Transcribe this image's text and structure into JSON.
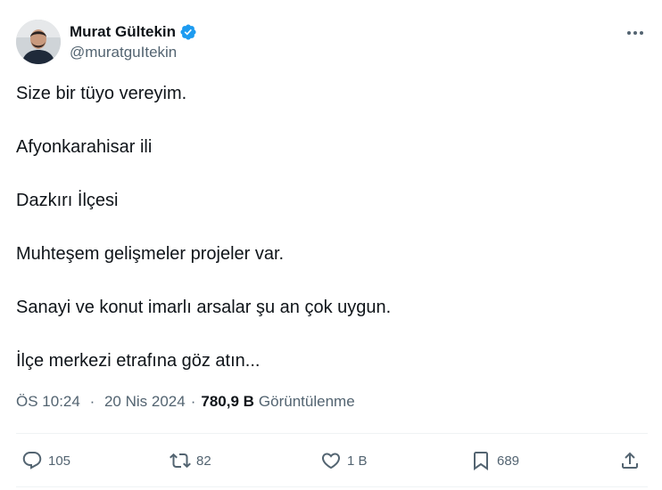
{
  "user": {
    "display_name": "Murat Gültekin",
    "handle": "@muratguItekin",
    "verified": true,
    "verified_color": "#1d9bf0"
  },
  "tweet": {
    "lines": [
      "Size bir tüyo vereyim.",
      "Afyonkarahisar ili",
      "Dazkırı İlçesi",
      "Muhteşem gelişmeler projeler var.",
      "Sanayi ve konut imarlı arsalar şu an çok uygun.",
      "İlçe merkezi etrafına göz atın..."
    ]
  },
  "meta": {
    "time": "ÖS 10:24",
    "separator": "·",
    "date": "20 Nis 2024",
    "views_count": "780,9 B",
    "views_label": "Görüntülenme"
  },
  "actions": {
    "replies": "105",
    "reposts": "82",
    "likes": "1 B",
    "bookmarks": "689"
  },
  "icons": {
    "more": "more-horizontal-icon",
    "reply": "reply-bubble-icon",
    "repost": "repost-icon",
    "like": "heart-icon",
    "bookmark": "bookmark-icon",
    "share": "share-icon"
  },
  "colors": {
    "text": "#0f1419",
    "secondary": "#536471",
    "divider": "#eff3f4"
  }
}
